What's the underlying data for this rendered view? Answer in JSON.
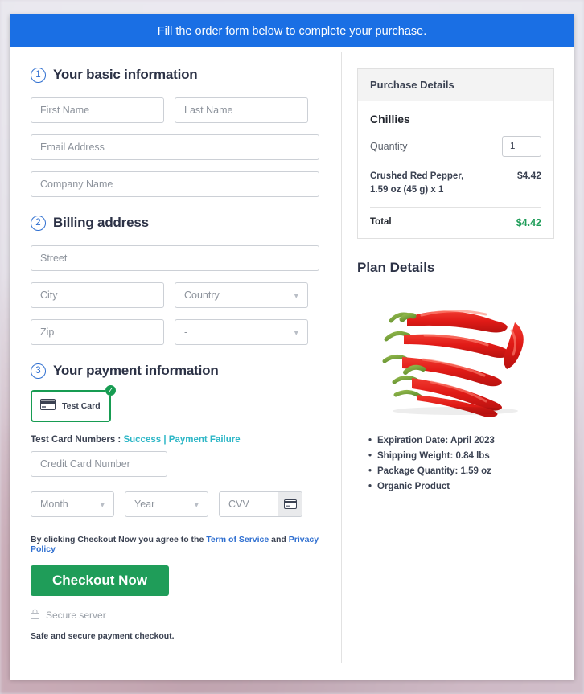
{
  "banner": {
    "text": "Fill the order form below to complete your purchase."
  },
  "sections": {
    "basic": {
      "number": "1",
      "title": "Your basic information",
      "fields": {
        "first_name": "First Name",
        "last_name": "Last Name",
        "email": "Email Address",
        "company": "Company Name"
      }
    },
    "billing": {
      "number": "2",
      "title": "Billing address",
      "fields": {
        "street": "Street",
        "city": "City",
        "country": "Country",
        "zip": "Zip",
        "state": "-"
      }
    },
    "payment": {
      "number": "3",
      "title": "Your payment information",
      "test_card_label": "Test  Card",
      "test_numbers_label": "Test Card Numbers :",
      "success_link": "Success",
      "separator": "|",
      "failure_link": "Payment Failure",
      "card_number": "Credit Card Number",
      "month": "Month",
      "year": "Year",
      "cvv": "CVV"
    }
  },
  "terms": {
    "prefix": "By clicking Checkout Now you agree to the",
    "tos": "Term of Service",
    "and": "and",
    "privacy": "Privacy Policy"
  },
  "checkout_button": "Checkout Now",
  "secure_server": "Secure server",
  "safe_note": "Safe and secure payment checkout.",
  "purchase": {
    "header": "Purchase Details",
    "product": "Chillies",
    "quantity_label": "Quantity",
    "quantity_value": "1",
    "line_item": {
      "description_line1": "Crushed Red Pepper,",
      "description_line2": "1.59 oz (45 g) x 1",
      "amount": "$4.42"
    },
    "total_label": "Total",
    "total_amount": "$4.42"
  },
  "plan": {
    "title": "Plan Details",
    "features": [
      "Expiration Date: April 2023",
      "Shipping Weight: 0.84 lbs",
      "Package Quantity: 1.59 oz",
      "Organic Product"
    ]
  },
  "colors": {
    "banner_blue": "#1a6fe4",
    "accent_blue": "#2f6fd0",
    "green": "#1f9d59",
    "teal_link": "#2cb6c6",
    "chilli_red": "#e02020",
    "stem_green": "#7aa43c"
  }
}
